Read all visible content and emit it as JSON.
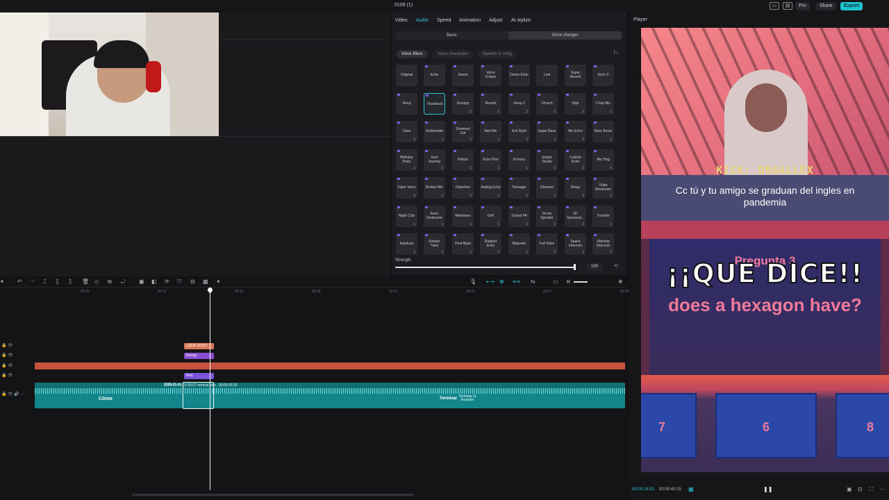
{
  "window": {
    "project_title": "0109 (1)",
    "pro_label": "Pro",
    "share_label": "Share",
    "export_label": "Export"
  },
  "props": {
    "tabs": [
      "Video",
      "Audio",
      "Speed",
      "Animation",
      "Adjust",
      "AI stylize"
    ],
    "active_tab": "Audio",
    "subtabs": [
      "Basic",
      "Voice changer"
    ],
    "filters": [
      "Voice filters",
      "Voice characters",
      "Speech to song"
    ],
    "voices": [
      [
        "Original",
        "Echo",
        "Sweet",
        "Voice Crisper",
        "Divine Echo",
        "Low",
        "Super Reverb",
        "Echo II"
      ],
      [
        "Deep",
        "Flashback",
        "Grumpy",
        "Reverb",
        "Deep 2",
        "Church",
        "High",
        "Crisp Mic"
      ],
      [
        "Cave",
        "Underwater",
        "Drowned Out",
        "Bad Mic",
        "Evil Spirit",
        "Super Bass",
        "Mic Echo",
        "Bass Boost"
      ],
      [
        "Birthday Party",
        "Soul Journey",
        "Helium",
        "Echo Plus",
        "Echoey",
        "Empty Studio",
        "Cubicle Echo",
        "Mic Hog"
      ],
      [
        "Fuller Voice",
        "Broken Mic",
        "Distortion",
        "Analog Echo",
        "Teenager",
        "Ethereal",
        "Wispy",
        "Outer Dimension"
      ],
      [
        "Night Club",
        "Sonic Destructor",
        "Memories",
        "Drift",
        "School PA",
        "Drone Speaker",
        "3D Surround...",
        "Tremble"
      ],
      [
        "Autotune",
        "Sinister Twist",
        "Post-Blast",
        "Radiant Echo",
        "Magnetic",
        "Full Voice",
        "Space Intercom",
        "Starship Intercom"
      ]
    ],
    "selected_voice": "Flashback",
    "strength_label": "Strength",
    "strength_value": "100",
    "strength_fraction": 1.0
  },
  "player": {
    "title": "Player",
    "time_current": "00:00:14:03",
    "time_total": "00:00:40:15",
    "video": {
      "kick_label": "KICK: DRGALLEX",
      "subtitle": "Cc tú y tu amigo se graduan del ingles en pandemia",
      "question_number": "Pregunta 3",
      "title_overlay": "¡¡QUE DICE!!",
      "question_text": "does a hexagon have?",
      "answers": [
        "7",
        "6",
        "8"
      ]
    }
  },
  "timeline": {
    "ruler_ticks": [
      "00:09",
      "00:12",
      "00:15",
      "00:18",
      "00:21",
      "00:24",
      "00:27",
      "00:30"
    ],
    "clip_title": "¡¡QUE DICE!!",
    "clip_effect": "Energy",
    "clip_filter": "Red",
    "video_track_label": "2026-01-08 01-50-07-vertical.mkv",
    "video_track_duration": "00:00:25:26",
    "video_track_prefix": "2026-01-0",
    "thumb_words": [
      "Cómo",
      "Terminar",
      "Terminar la invasión"
    ]
  }
}
